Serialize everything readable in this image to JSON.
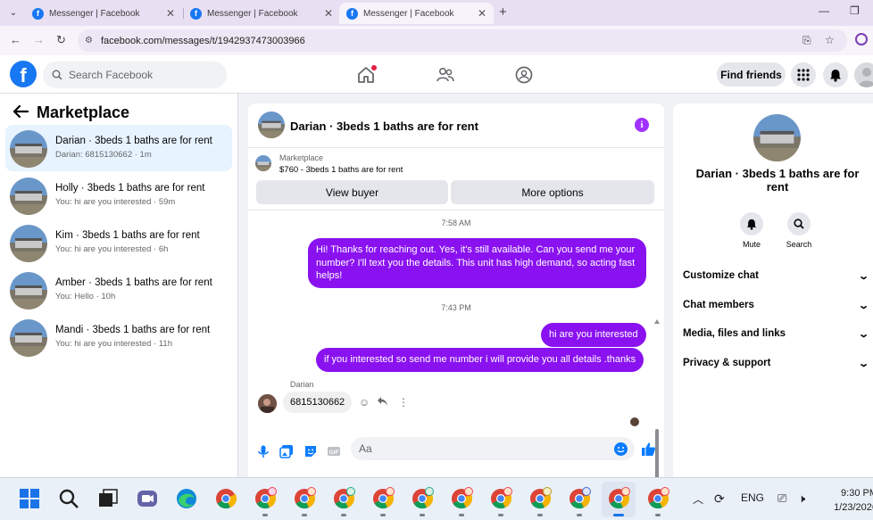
{
  "browser": {
    "tabs": [
      {
        "title": "Messenger | Facebook",
        "active": false
      },
      {
        "title": "Messenger | Facebook",
        "active": false
      },
      {
        "title": "Messenger | Facebook",
        "active": true
      }
    ],
    "url": "facebook.com/messages/t/1942937473003966"
  },
  "fb_header": {
    "search_placeholder": "Search Facebook",
    "find_friends_label": "Find friends"
  },
  "sidebar": {
    "title": "Marketplace",
    "conversations": [
      {
        "name": "Darian · 3beds 1 baths are for rent",
        "preview": "Darian: 6815130662 · 1m",
        "active": true
      },
      {
        "name": "Holly · 3beds 1 baths are for rent",
        "preview": "You: hi are you interested · 59m",
        "active": false
      },
      {
        "name": "Kim · 3beds 1 baths are for rent",
        "preview": "You: hi are you interested · 6h",
        "active": false
      },
      {
        "name": "Amber · 3beds 1 baths are for rent",
        "preview": "You: Hello · 10h",
        "active": false
      },
      {
        "name": "Mandi · 3beds 1 baths are for rent",
        "preview": "You: hi are you interested · 11h",
        "active": false
      }
    ]
  },
  "chat": {
    "title": "Darian · 3beds 1 baths are for rent",
    "marketplace_label": "Marketplace",
    "listing": "$760 - 3beds 1 baths are for rent",
    "view_buyer_label": "View buyer",
    "more_options_label": "More options",
    "messages": {
      "time1": "7:58 AM",
      "out1": "Hi! Thanks for reaching out. Yes, it's still available. Can you send me your number? I'll text you the details. This unit has high demand, so acting fast helps!",
      "time2": "7:43 PM",
      "out2": "hi are you interested",
      "out3": "if you interested so send me number i will provide you all details .thanks",
      "sender": "Darian",
      "in1": "6815130662"
    },
    "composer_placeholder": "Aa"
  },
  "details": {
    "name": "Darian · 3beds 1 baths are for rent",
    "actions": {
      "mute": "Mute",
      "search": "Search"
    },
    "sections": [
      "Customize chat",
      "Chat members",
      "Media, files and links",
      "Privacy & support"
    ]
  },
  "taskbar": {
    "language": "ENG",
    "time": "9:30 PM",
    "date": "1/23/2026"
  },
  "colors": {
    "fb_blue": "#1877f2",
    "bubble_purple": "#8a12f0",
    "active_conv_bg": "#e7f3ff"
  }
}
